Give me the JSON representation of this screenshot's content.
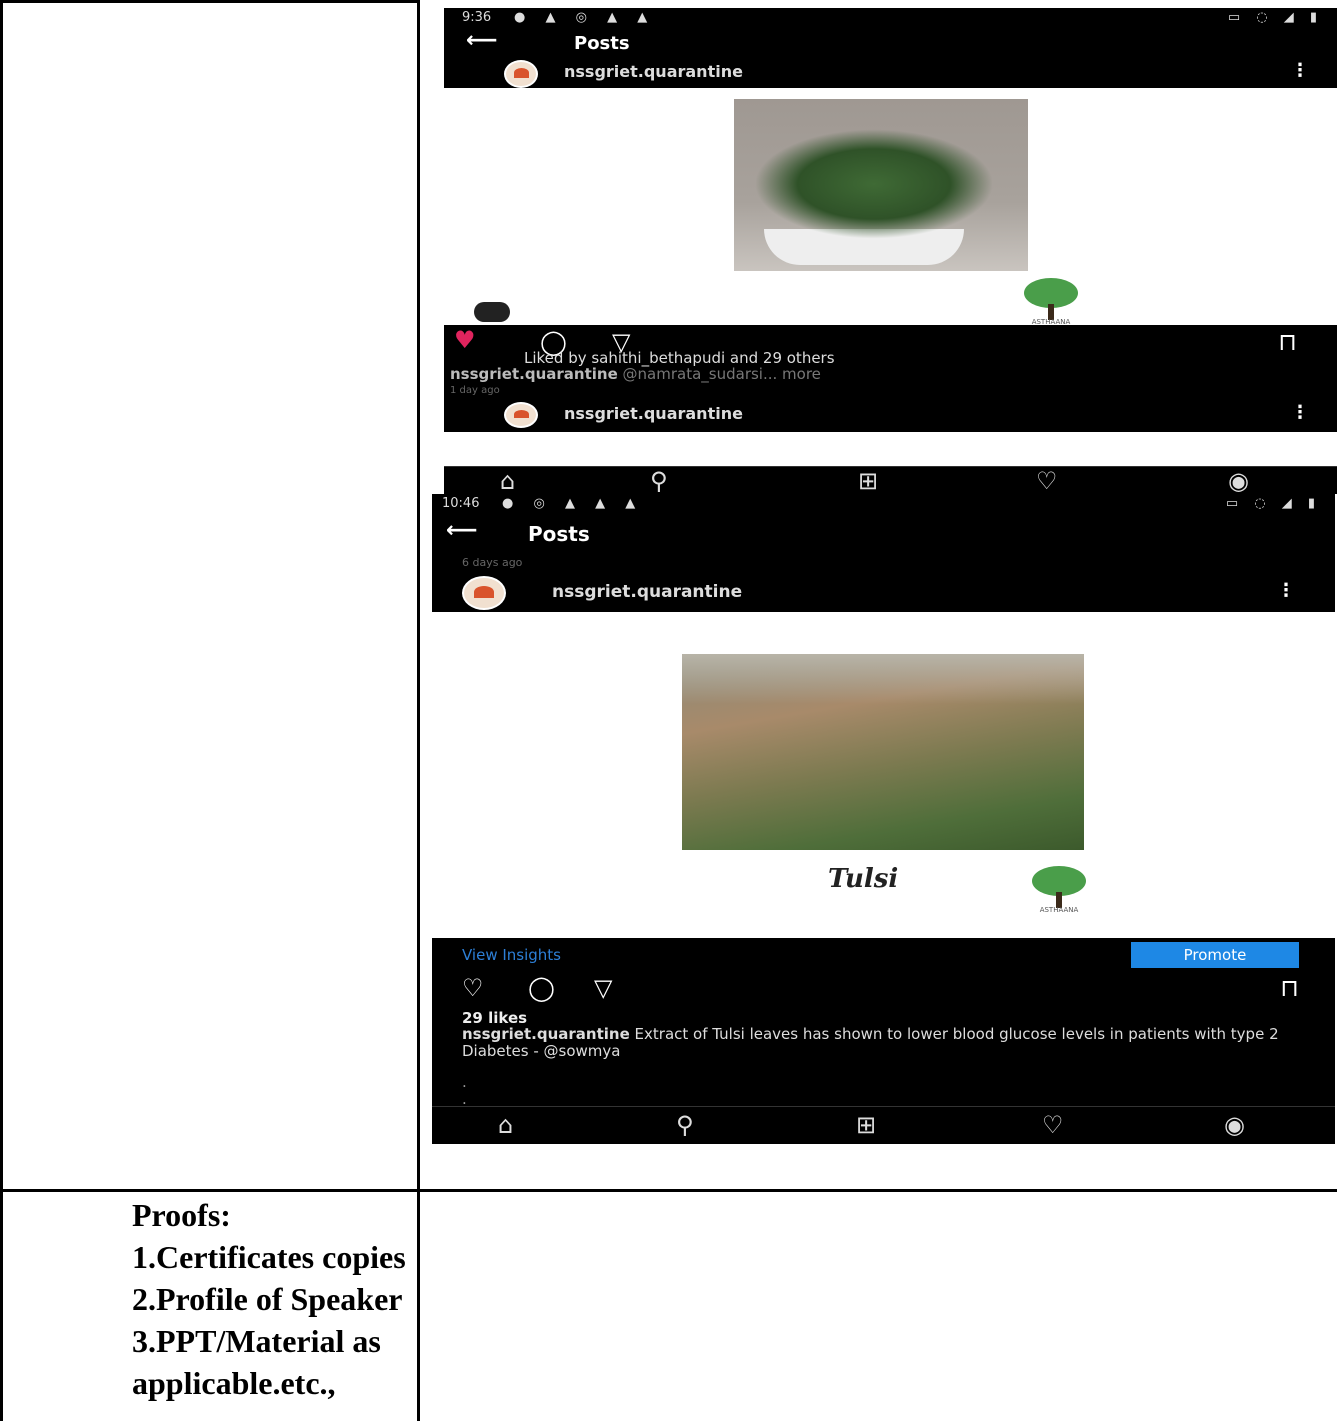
{
  "screenshot1": {
    "status_time": "9:36",
    "header_title": "Posts",
    "username": "nssgriet.quarantine",
    "liked_by": "Liked by sahithi_bethapudi and 29 others",
    "caption_user": "nssgriet.quarantine",
    "caption_text": "@namrata_sudarsi... more",
    "time_ago": "1 day ago",
    "next_username": "nssgriet.quarantine"
  },
  "screenshot2": {
    "status_time": "10:46",
    "header_title": "Posts",
    "days_ago": "6 days ago",
    "username": "nssgriet.quarantine",
    "image_caption": "Tulsi",
    "view_insights": "View Insights",
    "promote_label": "Promote",
    "likes": "29 likes",
    "caption_user": "nssgriet.quarantine",
    "caption_text": "Extract of Tulsi leaves has shown to lower blood glucose levels in patients with type 2 Diabetes - @sowmya",
    "caption_dots": ".\n."
  },
  "proofs": {
    "line1": "Proofs:",
    "line2": "1.Certificates copies",
    "line3": "2.Profile of Speaker",
    "line4": "3.PPT/Material as",
    "line5": "applicable.etc.,"
  },
  "icons": [
    "back-arrow-icon",
    "kebab-menu-icon",
    "heart-icon",
    "comment-icon",
    "share-icon",
    "bookmark-icon",
    "home-icon",
    "search-icon",
    "add-icon",
    "activity-icon",
    "profile-icon"
  ]
}
